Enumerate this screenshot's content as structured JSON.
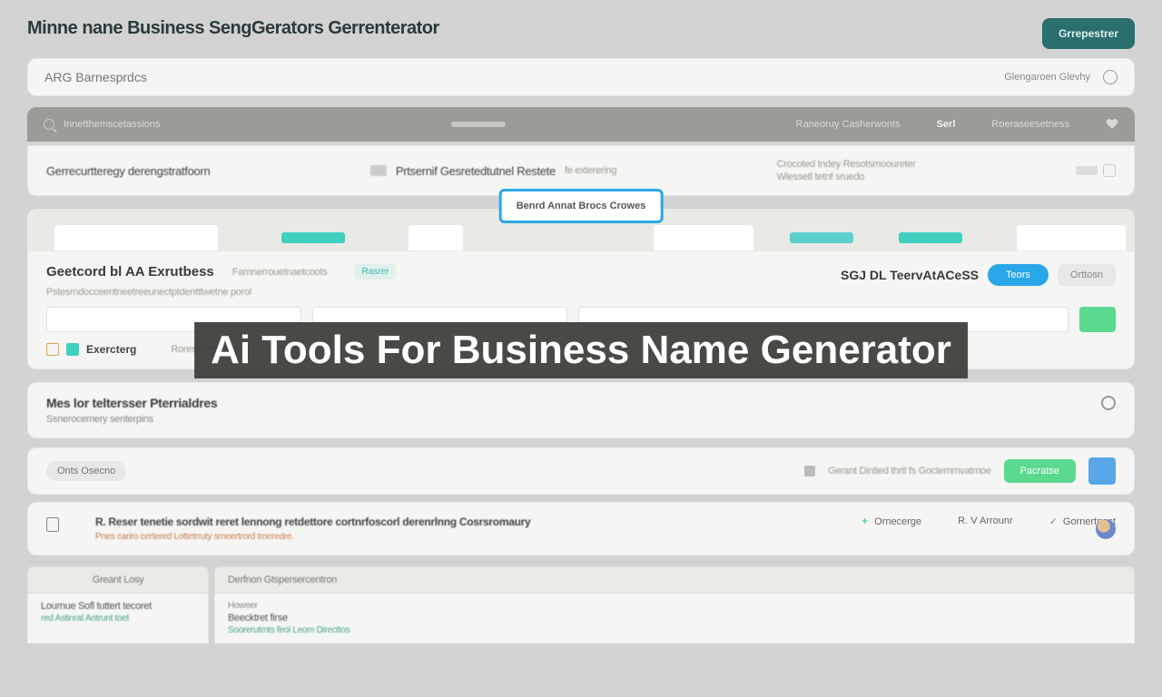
{
  "header": {
    "title": "Minne nane Business SengGerators Gerrenterator",
    "cta_button": "Grrepestrer"
  },
  "search": {
    "placeholder": "ARG Barnesprdcs",
    "right_label": "Glengaroen Glevhy"
  },
  "bar1": {
    "left_text": "Innetthemscetassions",
    "mid_text": "Raneoruy Casherwonts",
    "sort_label": "Serl",
    "right_text": "Roeraseesetness"
  },
  "bar2": {
    "left_label": "Gerrecurtteregy derengstratfoorn",
    "mid_label": "Prtsernif Gesretedtutnel Restete",
    "mid_sub": "fe exterering",
    "right_line1": "Crocoted tndey Resotsmooureter",
    "right_line2": "Wiessetl tetnf sruedo"
  },
  "selected_box": "Benrd Annat Brocs Crowes",
  "panel_a": {
    "title": "Geetcord bl AA Exrutbess",
    "sub1": "Famnerrouetnaetcoots",
    "sub2": "Pstesrndocceentneetreeunectptdentttwetne porol",
    "mini_tag": "Rasrer",
    "right_title": "SGJ DL TeervAtACeSS",
    "btn_blue": "Teors",
    "btn_grey": "Orttosn",
    "chip_label": "Exercterg",
    "chip_sub": "Roresl bferases"
  },
  "overlay": "Ai Tools For Business Name Generator",
  "panel_b": {
    "title": "Mes lor teltersser Pterrialdres",
    "sub": "Ssnerocemery senterpins"
  },
  "panel_c": {
    "pill": "Onts Osecno",
    "right_text": "Gerant Dintied thrtl fs Goctemmvatmoe",
    "green_btn": "Pacratse"
  },
  "panel_d": {
    "lead_title": "R. Reser tenetie sordwit reret lennong retdettore cortnrfoscorl derenrlnng Cosrsromaury",
    "lead_sub": "Pnes cariro certered Lottetrruty smeertrord tmeredre.",
    "col1": "Ornecerge",
    "col2": "R. V Arrounr",
    "col3": "Gornertnect"
  },
  "table": {
    "head1": "Greant Losy",
    "head2": "Derfnon Gtspersercentron",
    "cell1_line1": "Lournue Sofl tuttert tecoret",
    "cell1_line2": "red Astinrat Antrunt toet",
    "cell2_head": "Howeer",
    "cell2_line1": "Beecktret firse",
    "cell2_line2": "Soorerutrnts feol Leom Directtos"
  }
}
